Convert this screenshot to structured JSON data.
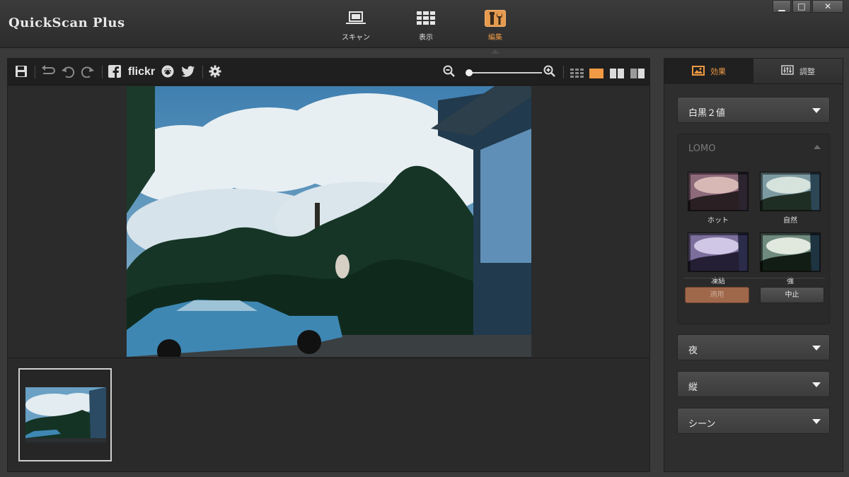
{
  "app": {
    "title": "QuickScan Plus"
  },
  "mode_tabs": [
    {
      "label": "スキャン",
      "icon": "scanner-icon"
    },
    {
      "label": "表示",
      "icon": "grid-view-icon"
    },
    {
      "label": "編集",
      "icon": "edit-tools-icon",
      "active": true
    }
  ],
  "window_controls": {
    "minimize": "▁",
    "maximize": "□",
    "close": "✕"
  },
  "toolbar": {
    "flickr_label": "flickr",
    "icons": [
      "save-icon",
      "revert-icon",
      "undo-icon",
      "redo-icon",
      "facebook-icon",
      "flickr-icon",
      "aperture-icon",
      "twitter-icon",
      "gear-icon",
      "zoom-out-icon",
      "zoom-in-icon",
      "grid-view-icon",
      "single-view-icon",
      "side-by-side-view-icon",
      "split-view-icon"
    ],
    "active_view": "single-view-icon"
  },
  "side_panel": {
    "tabs": [
      {
        "label": "効果",
        "icon": "image-icon",
        "active": true
      },
      {
        "label": "調整",
        "icon": "sliders-icon"
      }
    ],
    "dropdowns": {
      "bw": "白黒２値",
      "night": "夜",
      "vertical": "縦",
      "scene": "シーン"
    },
    "lomo": {
      "title": "LOMO",
      "presets": [
        "ホット",
        "自然",
        "凍結",
        "強"
      ],
      "apply_label": "適用",
      "cancel_label": "中止"
    }
  },
  "colors": {
    "accent": "#f09a44",
    "panel": "#2c2c2c",
    "toolbar": "#1f1f1f"
  }
}
